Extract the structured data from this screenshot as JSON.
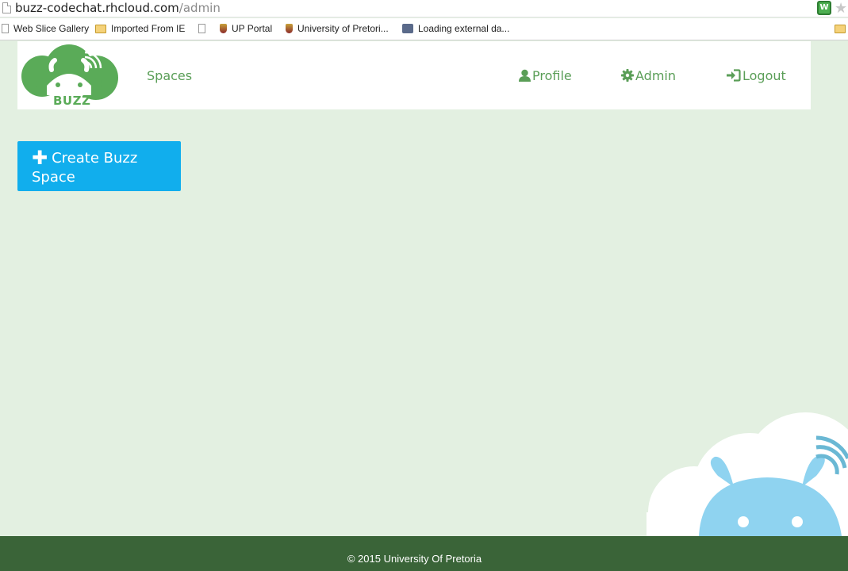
{
  "browser": {
    "url_host": "buzz-codechat.rhcloud.com",
    "url_path": "/admin",
    "bookmarks": [
      {
        "label": "Web Slice Gallery",
        "icon": "page-icon"
      },
      {
        "label": "Imported From IE",
        "icon": "folder-icon"
      },
      {
        "label": "UP Portal",
        "icon": "crest-icon"
      },
      {
        "label": "University of Pretori...",
        "icon": "crest-icon"
      },
      {
        "label": "Loading external da...",
        "icon": "app-icon"
      }
    ]
  },
  "header": {
    "logo_text": "BUZZ",
    "nav": {
      "spaces": "Spaces",
      "profile": "Profile",
      "admin": "Admin",
      "logout": "Logout"
    }
  },
  "main": {
    "create_button_label": "Create Buzz Space"
  },
  "footer": {
    "text": "© 2015 University Of Pretoria"
  },
  "colors": {
    "page_bg": "#e3f0e1",
    "brand_green": "#5aab58",
    "button_blue": "#11aeed",
    "footer_bg": "#3a6438",
    "mascot_blue": "#8fd3f0"
  }
}
